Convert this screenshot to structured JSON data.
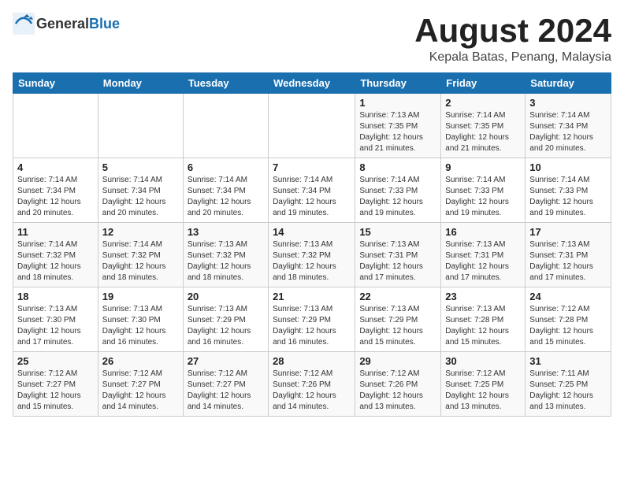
{
  "logo": {
    "text_general": "General",
    "text_blue": "Blue"
  },
  "title": "August 2024",
  "location": "Kepala Batas, Penang, Malaysia",
  "days_of_week": [
    "Sunday",
    "Monday",
    "Tuesday",
    "Wednesday",
    "Thursday",
    "Friday",
    "Saturday"
  ],
  "weeks": [
    [
      {
        "day": "",
        "info": ""
      },
      {
        "day": "",
        "info": ""
      },
      {
        "day": "",
        "info": ""
      },
      {
        "day": "",
        "info": ""
      },
      {
        "day": "1",
        "info": "Sunrise: 7:13 AM\nSunset: 7:35 PM\nDaylight: 12 hours\nand 21 minutes."
      },
      {
        "day": "2",
        "info": "Sunrise: 7:14 AM\nSunset: 7:35 PM\nDaylight: 12 hours\nand 21 minutes."
      },
      {
        "day": "3",
        "info": "Sunrise: 7:14 AM\nSunset: 7:34 PM\nDaylight: 12 hours\nand 20 minutes."
      }
    ],
    [
      {
        "day": "4",
        "info": "Sunrise: 7:14 AM\nSunset: 7:34 PM\nDaylight: 12 hours\nand 20 minutes."
      },
      {
        "day": "5",
        "info": "Sunrise: 7:14 AM\nSunset: 7:34 PM\nDaylight: 12 hours\nand 20 minutes."
      },
      {
        "day": "6",
        "info": "Sunrise: 7:14 AM\nSunset: 7:34 PM\nDaylight: 12 hours\nand 20 minutes."
      },
      {
        "day": "7",
        "info": "Sunrise: 7:14 AM\nSunset: 7:34 PM\nDaylight: 12 hours\nand 19 minutes."
      },
      {
        "day": "8",
        "info": "Sunrise: 7:14 AM\nSunset: 7:33 PM\nDaylight: 12 hours\nand 19 minutes."
      },
      {
        "day": "9",
        "info": "Sunrise: 7:14 AM\nSunset: 7:33 PM\nDaylight: 12 hours\nand 19 minutes."
      },
      {
        "day": "10",
        "info": "Sunrise: 7:14 AM\nSunset: 7:33 PM\nDaylight: 12 hours\nand 19 minutes."
      }
    ],
    [
      {
        "day": "11",
        "info": "Sunrise: 7:14 AM\nSunset: 7:32 PM\nDaylight: 12 hours\nand 18 minutes."
      },
      {
        "day": "12",
        "info": "Sunrise: 7:14 AM\nSunset: 7:32 PM\nDaylight: 12 hours\nand 18 minutes."
      },
      {
        "day": "13",
        "info": "Sunrise: 7:13 AM\nSunset: 7:32 PM\nDaylight: 12 hours\nand 18 minutes."
      },
      {
        "day": "14",
        "info": "Sunrise: 7:13 AM\nSunset: 7:32 PM\nDaylight: 12 hours\nand 18 minutes."
      },
      {
        "day": "15",
        "info": "Sunrise: 7:13 AM\nSunset: 7:31 PM\nDaylight: 12 hours\nand 17 minutes."
      },
      {
        "day": "16",
        "info": "Sunrise: 7:13 AM\nSunset: 7:31 PM\nDaylight: 12 hours\nand 17 minutes."
      },
      {
        "day": "17",
        "info": "Sunrise: 7:13 AM\nSunset: 7:31 PM\nDaylight: 12 hours\nand 17 minutes."
      }
    ],
    [
      {
        "day": "18",
        "info": "Sunrise: 7:13 AM\nSunset: 7:30 PM\nDaylight: 12 hours\nand 17 minutes."
      },
      {
        "day": "19",
        "info": "Sunrise: 7:13 AM\nSunset: 7:30 PM\nDaylight: 12 hours\nand 16 minutes."
      },
      {
        "day": "20",
        "info": "Sunrise: 7:13 AM\nSunset: 7:29 PM\nDaylight: 12 hours\nand 16 minutes."
      },
      {
        "day": "21",
        "info": "Sunrise: 7:13 AM\nSunset: 7:29 PM\nDaylight: 12 hours\nand 16 minutes."
      },
      {
        "day": "22",
        "info": "Sunrise: 7:13 AM\nSunset: 7:29 PM\nDaylight: 12 hours\nand 15 minutes."
      },
      {
        "day": "23",
        "info": "Sunrise: 7:13 AM\nSunset: 7:28 PM\nDaylight: 12 hours\nand 15 minutes."
      },
      {
        "day": "24",
        "info": "Sunrise: 7:12 AM\nSunset: 7:28 PM\nDaylight: 12 hours\nand 15 minutes."
      }
    ],
    [
      {
        "day": "25",
        "info": "Sunrise: 7:12 AM\nSunset: 7:27 PM\nDaylight: 12 hours\nand 15 minutes."
      },
      {
        "day": "26",
        "info": "Sunrise: 7:12 AM\nSunset: 7:27 PM\nDaylight: 12 hours\nand 14 minutes."
      },
      {
        "day": "27",
        "info": "Sunrise: 7:12 AM\nSunset: 7:27 PM\nDaylight: 12 hours\nand 14 minutes."
      },
      {
        "day": "28",
        "info": "Sunrise: 7:12 AM\nSunset: 7:26 PM\nDaylight: 12 hours\nand 14 minutes."
      },
      {
        "day": "29",
        "info": "Sunrise: 7:12 AM\nSunset: 7:26 PM\nDaylight: 12 hours\nand 13 minutes."
      },
      {
        "day": "30",
        "info": "Sunrise: 7:12 AM\nSunset: 7:25 PM\nDaylight: 12 hours\nand 13 minutes."
      },
      {
        "day": "31",
        "info": "Sunrise: 7:11 AM\nSunset: 7:25 PM\nDaylight: 12 hours\nand 13 minutes."
      }
    ]
  ]
}
